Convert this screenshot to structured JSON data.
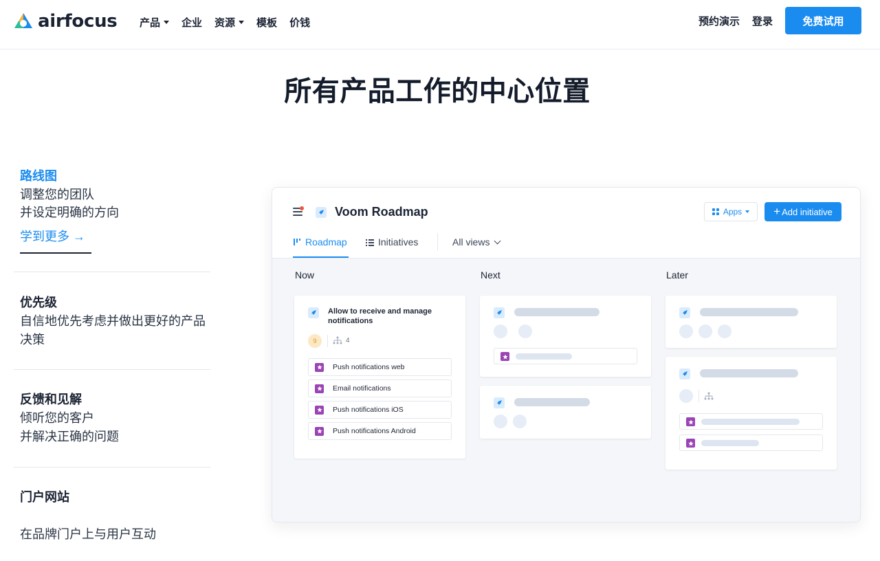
{
  "header": {
    "logo_text": "airfocus",
    "nav": [
      {
        "label": "产品",
        "dropdown": true
      },
      {
        "label": "企业",
        "dropdown": false
      },
      {
        "label": "资源",
        "dropdown": true
      },
      {
        "label": "模板",
        "dropdown": false
      },
      {
        "label": "价钱",
        "dropdown": false
      }
    ],
    "demo_label": "预约演示",
    "login_label": "登录",
    "cta_label": "免费试用"
  },
  "hero": {
    "title": "所有产品工作的中心位置"
  },
  "features": [
    {
      "title": "路线图",
      "lines": [
        "调整您的团队",
        "并设定明确的方向"
      ],
      "link": "学到更多 →",
      "active": true
    },
    {
      "title": "优先级",
      "lines": [
        "自信地优先考虑并做出更好的产品",
        "决策"
      ],
      "active": false
    },
    {
      "title": "反馈和见解",
      "lines": [
        "倾听您的客户",
        "并解决正确的问题"
      ],
      "active": false
    },
    {
      "title": "门户网站",
      "lines": [
        "在品牌门户上与用户互动"
      ],
      "active": false
    }
  ],
  "app": {
    "title": "Voom Roadmap",
    "apps_label": "Apps",
    "add_label": "Add initiative",
    "tabs": {
      "roadmap": "Roadmap",
      "initiatives": "Initiatives",
      "all_views": "All views"
    },
    "columns": {
      "now": "Now",
      "next": "Next",
      "later": "Later"
    },
    "main_card": {
      "title": "Allow to receive and manage notifications",
      "score": "9",
      "children_count": "4",
      "items": [
        "Push notifications web",
        "Email notifications",
        "Push notifications iOS",
        "Push notifications Android"
      ]
    }
  },
  "colors": {
    "accent": "#1a8cf0",
    "text": "#1b2333",
    "item_icon": "#9a43b5",
    "score_bg": "#fde8c4"
  },
  "icons": [
    "airfocus-logo-icon",
    "hamburger-menu-icon",
    "rocket-icon",
    "apps-grid-icon",
    "plus-icon",
    "roadmap-icon",
    "list-icon",
    "chevron-down-icon",
    "star-icon",
    "hierarchy-icon"
  ]
}
